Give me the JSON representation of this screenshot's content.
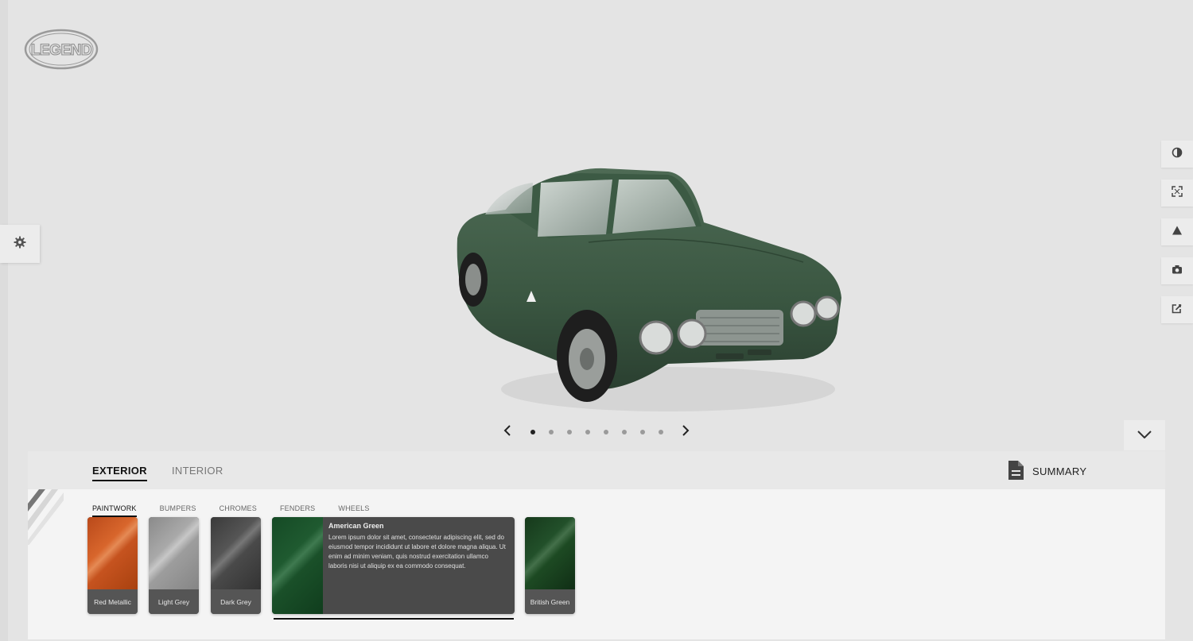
{
  "brand": {
    "logo_text": "LEGEND"
  },
  "tabs": {
    "exterior": "EXTERIOR",
    "interior": "INTERIOR",
    "summary": "SUMMARY"
  },
  "subtabs": [
    "PAINTWORK",
    "BUMPERS",
    "CHROMES",
    "FENDERS",
    "WHEELS"
  ],
  "active_subtab": "PAINTWORK",
  "carousel": {
    "slide_count": 8,
    "active_slide": 1
  },
  "swatches": [
    {
      "name": "Red Metallic",
      "color": "#c4551e"
    },
    {
      "name": "Light Grey",
      "color": "#9d9d9d"
    },
    {
      "name": "Dark Grey",
      "color": "#4a4a4a"
    },
    {
      "name": "American Green",
      "color": "#1f5a30",
      "selected": true,
      "description": "Lorem ipsum dolor sit amet, consectetur adipiscing elit, sed do eiusmod tempor incididunt ut labore et dolore magna aliqua. Ut enim ad minim veniam, quis nostrud exercitation ullamco laboris nisi ut aliquip ex ea commodo consequat."
    },
    {
      "name": "British Green",
      "color": "#1c4a22"
    }
  ],
  "side_tools": [
    "contrast-icon",
    "fullscreen-icon",
    "ar-icon",
    "camera-icon",
    "share-icon"
  ],
  "colors": {
    "background": "#e4e4e4",
    "panel": "#f4f4f4",
    "car_body": "#3f5e47"
  }
}
